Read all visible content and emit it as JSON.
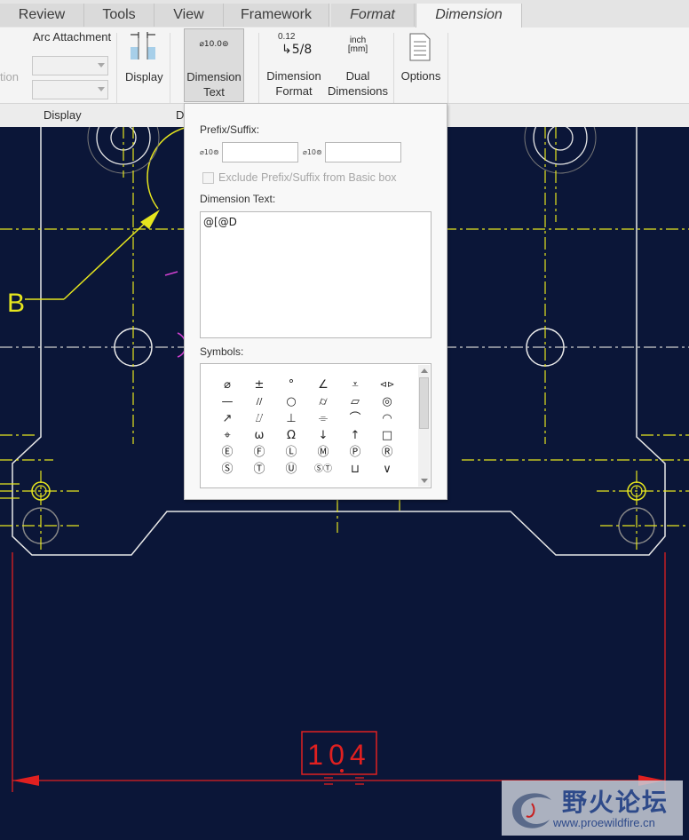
{
  "tabs": [
    {
      "label": "Review"
    },
    {
      "label": "Tools"
    },
    {
      "label": "View"
    },
    {
      "label": "Framework"
    },
    {
      "label": "Format"
    },
    {
      "label": "Dimension"
    }
  ],
  "ribbon": {
    "clipped_label": "tion",
    "arc_attachment_label": "Arc Attachment",
    "display_button_label": "Display",
    "dimension_text_button": {
      "line1": "Dimension",
      "line2": "Text",
      "icon_text": "⌀10.0⊚"
    },
    "dimension_format_button": {
      "line1": "Dimension",
      "line2": "Format",
      "icon_top": "0.12",
      "icon_bottom": "5/8"
    },
    "dual_dimensions_button": {
      "line1": "Dual",
      "line2": "Dimensions",
      "icon_top": "inch",
      "icon_bottom": "[mm]"
    },
    "options_button": {
      "label": "Options"
    },
    "group_display_label": "Display",
    "group_d_label": "D"
  },
  "popup": {
    "prefix_suffix_label": "Prefix/Suffix:",
    "prefix_icon": "⌀10⊚",
    "suffix_icon": "⌀10⊚",
    "prefix_value": "",
    "suffix_value": "",
    "exclude_label": "Exclude Prefix/Suffix from Basic box",
    "dimension_text_label": "Dimension Text:",
    "dimension_text_value": "@[@D",
    "symbols_label": "Symbols:",
    "symbols": [
      [
        "⌀",
        "±",
        "°",
        "∠",
        "⩡",
        "⊲⊳"
      ],
      [
        "—",
        "//",
        "○",
        "⌭",
        "▱",
        "◎"
      ],
      [
        "↗",
        "⌰",
        "⊥",
        "⌯",
        "⌒",
        "◠"
      ],
      [
        "⌖",
        "ω",
        "Ω",
        "↓",
        "↑",
        "□"
      ],
      [
        "Ⓔ",
        "Ⓕ",
        "Ⓛ",
        "Ⓜ",
        "Ⓟ",
        "Ⓡ"
      ],
      [
        "Ⓢ",
        "Ⓣ",
        "Ⓤ",
        "ⓈⓉ",
        "⊔",
        "∨"
      ]
    ]
  },
  "drawing": {
    "datum_label": "B",
    "dimension_value": "104"
  },
  "watermark": {
    "title": "野火论坛",
    "url": "www.proewildfire.cn"
  },
  "colors": {
    "background": "#0b1638",
    "geometry": "#e8e8e8",
    "centerline": "#e6e61e",
    "dimension": "#e02020",
    "accent_magenta": "#d040d0"
  }
}
